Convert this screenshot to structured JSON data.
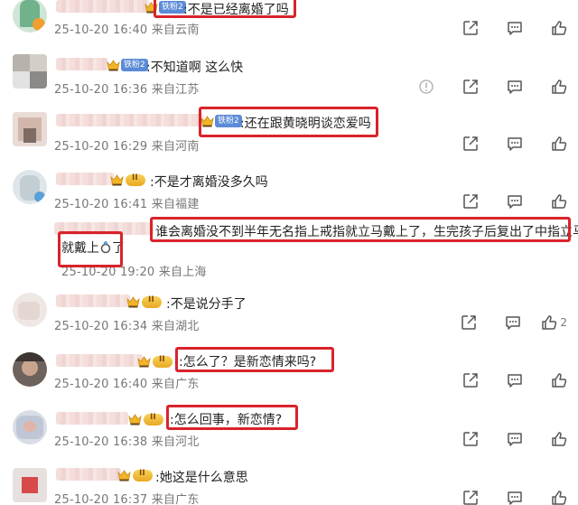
{
  "comments": [
    {
      "text": ":不是已经离婚了吗",
      "time": "25-10-20 16:40",
      "location": "来自云南",
      "badge": "铁粉2"
    },
    {
      "text": ":不知道啊 这么快",
      "time": "25-10-20 16:36",
      "location": "来自江苏",
      "badge": "铁粉2"
    },
    {
      "text": ":还在跟黄晓明谈恋爱吗",
      "time": "25-10-20 16:29",
      "location": "来自河南",
      "badge": "铁粉2"
    },
    {
      "text": ":不是才离婚没多久吗",
      "time": "25-10-20 16:41",
      "location": "来自福建"
    },
    {
      "text": ":不是说分手了",
      "time": "25-10-20 16:34",
      "location": "来自湖北",
      "likes": "2"
    },
    {
      "text": ":怎么了？是新恋情来吗?",
      "time": "25-10-20 16:40",
      "location": "来自广东"
    },
    {
      "text": ":怎么回事，新恋情?",
      "time": "25-10-20 16:38",
      "location": "来自河北"
    },
    {
      "text": ":她这是什么意思",
      "time": "25-10-20 16:37",
      "location": "来自广东"
    }
  ],
  "reply": {
    "line1": "谁会离婚没不到半年无名指上戒指就立马戴上了，生完孩子后复出了中指立马",
    "line2a": "就戴上",
    "line2b": "了",
    "time": "25-10-20 19:20",
    "location": "来自上海"
  },
  "icons": {
    "share": "share-icon",
    "comment": "comment-icon",
    "like": "thumb-up-icon",
    "report": "report-icon",
    "ring": "ring-icon"
  },
  "colors": {
    "highlight": "#d9232a",
    "fan_badge": "#5b8bd6"
  }
}
